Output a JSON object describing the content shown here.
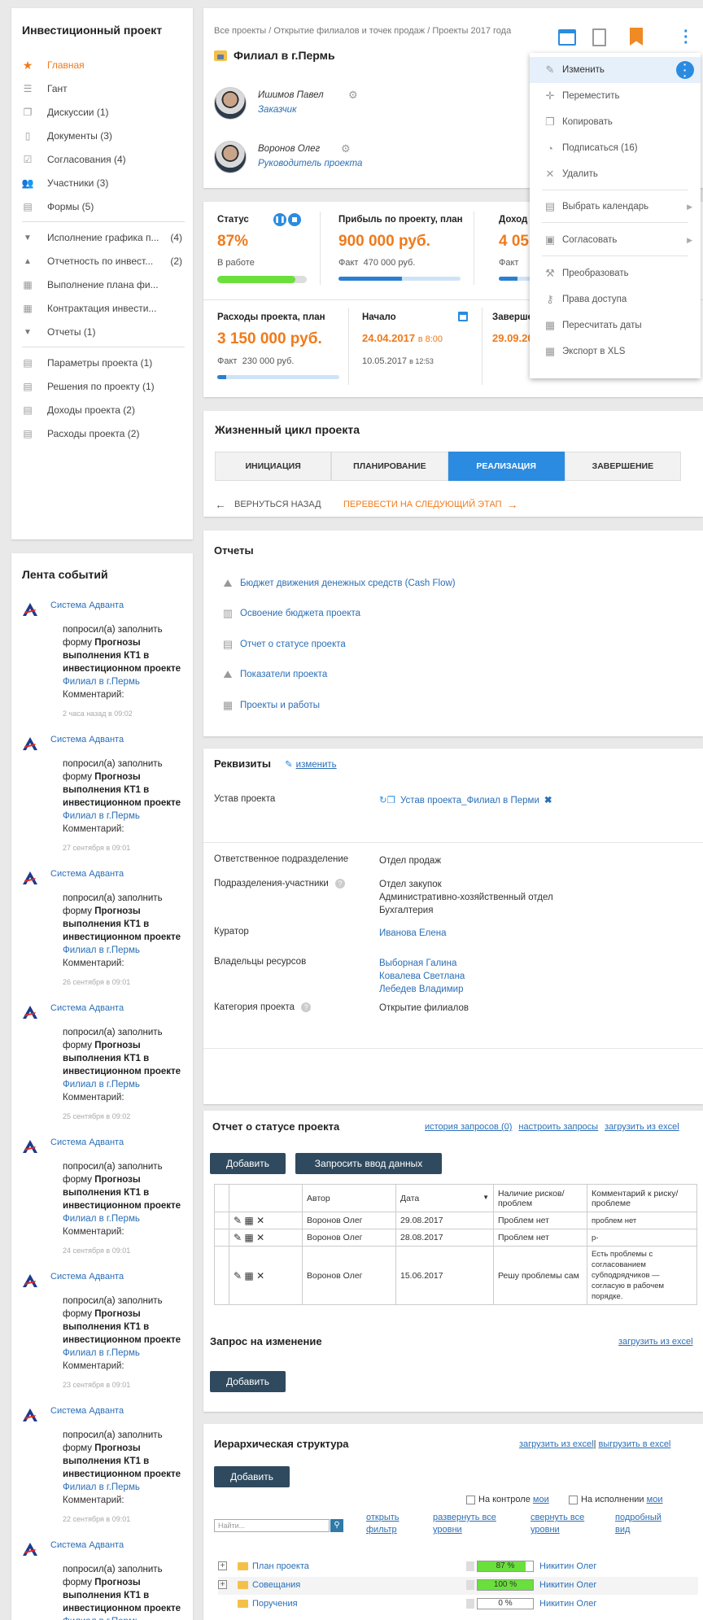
{
  "nav": {
    "title": "Инвестиционный проект",
    "items": [
      {
        "label": "Главная",
        "count": ""
      },
      {
        "label": "Гант",
        "count": ""
      },
      {
        "label": "Дискуссии (1)",
        "count": ""
      },
      {
        "label": "Документы (3)",
        "count": ""
      },
      {
        "label": "Согласования (4)",
        "count": ""
      },
      {
        "label": "Участники (3)",
        "count": ""
      },
      {
        "label": "Формы (5)",
        "count": ""
      }
    ],
    "groups": [
      {
        "label": "Исполнение графика п...",
        "count": "(4)"
      },
      {
        "label": "Отчетность по инвест...",
        "count": "(2)"
      },
      {
        "label": "Выполнение плана фи...",
        "count": ""
      },
      {
        "label": "Контрактация инвести...",
        "count": ""
      },
      {
        "label": "Отчеты (1)",
        "count": ""
      }
    ],
    "params": [
      {
        "label": "Параметры проекта (1)"
      },
      {
        "label": "Решения по проекту (1)"
      },
      {
        "label": "Доходы проекта (2)"
      },
      {
        "label": "Расходы проекта (2)"
      }
    ]
  },
  "feed": {
    "title": "Лента событий",
    "events": [
      {
        "who": "Система Адванта",
        "t1": "попросил(а) заполнить форму ",
        "b": "Прогнозы выполнения КТ1 в инвестиционном проекте",
        "lnk": "Филиал в г.Пермь",
        "com": "Комментарий:",
        "time": "2 часа назад в 09:02"
      },
      {
        "who": "Система Адванта",
        "t1": "попросил(а) заполнить форму ",
        "b": "Прогнозы выполнения КТ1 в инвестиционном проекте",
        "lnk": "Филиал в г.Пермь",
        "com": "Комментарий:",
        "time": "27 сентября в 09:01"
      },
      {
        "who": "Система Адванта",
        "t1": "попросил(а) заполнить форму ",
        "b": "Прогнозы выполнения КТ1 в инвестиционном проекте",
        "lnk": "Филиал в г.Пермь",
        "com": "Комментарий:",
        "time": "26 сентября в 09:01"
      },
      {
        "who": "Система Адванта",
        "t1": "попросил(а) заполнить форму ",
        "b": "Прогнозы выполнения КТ1 в инвестиционном проекте",
        "lnk": "Филиал в г.Пермь",
        "com": "Комментарий:",
        "time": "25 сентября в 09:02"
      },
      {
        "who": "Система Адванта",
        "t1": "попросил(а) заполнить форму ",
        "b": "Прогнозы выполнения КТ1 в инвестиционном проекте",
        "lnk": "Филиал в г.Пермь",
        "com": "Комментарий:",
        "time": "24 сентября в 09:01"
      },
      {
        "who": "Система Адванта",
        "t1": "попросил(а) заполнить форму ",
        "b": "Прогнозы выполнения КТ1 в инвестиционном проекте",
        "lnk": "Филиал в г.Пермь",
        "com": "Комментарий:",
        "time": "23 сентября в 09:01"
      },
      {
        "who": "Система Адванта",
        "t1": "попросил(а) заполнить форму ",
        "b": "Прогнозы выполнения КТ1 в инвестиционном проекте",
        "lnk": "Филиал в г.Пермь",
        "com": "Комментарий:",
        "time": "22 сентября в 09:01"
      },
      {
        "who": "Система Адванта",
        "t1": "попросил(а) заполнить форму ",
        "b": "Прогнозы выполнения КТ1 в инвестиционном проекте",
        "lnk": "Филиал в г.Пермь",
        "com": "",
        "time": ""
      }
    ]
  },
  "header": {
    "breadcrumb": "Все проекты / Открытие филиалов и точек продаж / Проекты 2017 года",
    "title": "Филиал в г.Пермь",
    "people": [
      {
        "name": "Ишимов Павел",
        "role": "Заказчик"
      },
      {
        "name": "Воронов Олег",
        "role": "Руководитель проекта"
      }
    ]
  },
  "stats": {
    "status_label": "Статус",
    "status_value": "87%",
    "status_sub": "В работе",
    "status_progress": 0.87,
    "profit_label": "Прибыль по проекту, план",
    "profit_value": "900 000 руб.",
    "profit_fact_label": "Факт",
    "profit_fact": "470 000 руб.",
    "profit_progress": 0.52,
    "income_label": "Доход",
    "income_value": "4 05",
    "income_fact_label": "Факт",
    "income_progress": 0.15,
    "cost_label": "Расходы проекта, план",
    "cost_value": "3 150 000 руб.",
    "cost_fact_label": "Факт",
    "cost_fact": "230 000 руб.",
    "cost_progress": 0.07,
    "start_label": "Начало",
    "start_date": "24.04.2017",
    "start_time": "в 8:00",
    "start_actual": "10.05.2017",
    "start_actual_time": "в 12:53",
    "end_label": "Завершение",
    "end_date": "29.09.20"
  },
  "lifecycle": {
    "title": "Жизненный цикл проекта",
    "steps": [
      "ИНИЦИАЦИЯ",
      "ПЛАНИРОВАНИЕ",
      "РЕАЛИЗАЦИЯ",
      "ЗАВЕРШЕНИЕ"
    ],
    "current": "РЕАЛИЗАЦИЯ",
    "back": "ВЕРНУТЬСЯ НАЗАД",
    "next": "ПЕРЕВЕСТИ НА СЛЕДУЮЩИЙ ЭТАП"
  },
  "reports": {
    "title": "Отчеты",
    "items": [
      "Бюджет движения денежных средств (Cash Flow)",
      "Освоение бюджета проекта",
      "Отчет о статусе проекта",
      "Показатели проекта",
      "Проекты и работы"
    ]
  },
  "requisites": {
    "title": "Реквизиты",
    "edit": "изменить",
    "rows": {
      "charter_label": "Устав проекта",
      "charter_value": "Устав проекта_Филиал в Перми",
      "dept_label": "Ответственное подразделение",
      "dept_value": "Отдел продаж",
      "part_label": "Подразделения-участники",
      "part_values": [
        "Отдел закупок",
        "Административно-хозяйственный отдел",
        "Бухгалтерия"
      ],
      "curator_label": "Куратор",
      "curator_value": "Иванова Елена",
      "owners_label": "Владельцы ресурсов",
      "owners_values": [
        "Выборная Галина",
        "Ковалева Светлана",
        "Лебедев Владимир"
      ],
      "cat_label": "Категория проекта",
      "cat_value": "Открытие филиалов"
    }
  },
  "status_report": {
    "title": "Отчет о статусе проекта",
    "links": [
      "история запросов (0)",
      "настроить запросы",
      "загрузить из excel"
    ],
    "add_btn": "Добавить",
    "request_btn": "Запросить ввод данных",
    "columns": [
      "Автор",
      "Дата",
      "Наличие рисков/ проблем",
      "Комментарий к риску/проблеме"
    ],
    "rows": [
      {
        "author": "Воронов Олег",
        "date": "29.08.2017",
        "risk": "Проблем нет",
        "comment": "проблем нет"
      },
      {
        "author": "Воронов Олег",
        "date": "28.08.2017",
        "risk": "Проблем нет",
        "comment": "р-"
      },
      {
        "author": "Воронов Олег",
        "date": "15.06.2017",
        "risk": "Решу проблемы сам",
        "comment": "Есть проблемы с согласованием субподрядчиков — согласую в рабочем порядке."
      }
    ],
    "change_title": "Запрос на изменение",
    "change_link": "загрузить из excel",
    "change_add": "Добавить"
  },
  "hierarchy": {
    "title": "Иерархическая структура",
    "link_load": "загрузить из excel",
    "link_export": "выгрузить в excel",
    "add_btn": "Добавить",
    "chk_control": "На контроле",
    "chk_control_link": "мои",
    "chk_exec": "На исполнении",
    "chk_exec_link": "мои",
    "search_placeholder": "Найти...",
    "open_filter": "открыть фильтр",
    "expand_all": "развернуть все уровни",
    "collapse_all": "свернуть все уровни",
    "detail_view": "подробный вид",
    "rows": [
      {
        "name": "План проекта",
        "progress_label": "87 %",
        "progress": 0.87,
        "owner": "Никитин Олег"
      },
      {
        "name": "Совещания",
        "progress_label": "100 %",
        "progress": 1.0,
        "owner": "Никитин Олег"
      },
      {
        "name": "Поручения",
        "progress_label": "0 %",
        "progress": 0,
        "owner": "Никитин Олег"
      }
    ]
  },
  "menu": {
    "items": [
      "Изменить",
      "Переместить",
      "Копировать",
      "Подписаться (16)",
      "Удалить",
      "Выбрать календарь",
      "Согласовать",
      "Преобразовать",
      "Права доступа",
      "Пересчитать даты",
      "Экспорт в XLS"
    ]
  },
  "colors": {
    "accent": "#f07a1a",
    "link": "#2a6fb7",
    "primary": "#2a8be0",
    "button": "#2f4a5f"
  }
}
